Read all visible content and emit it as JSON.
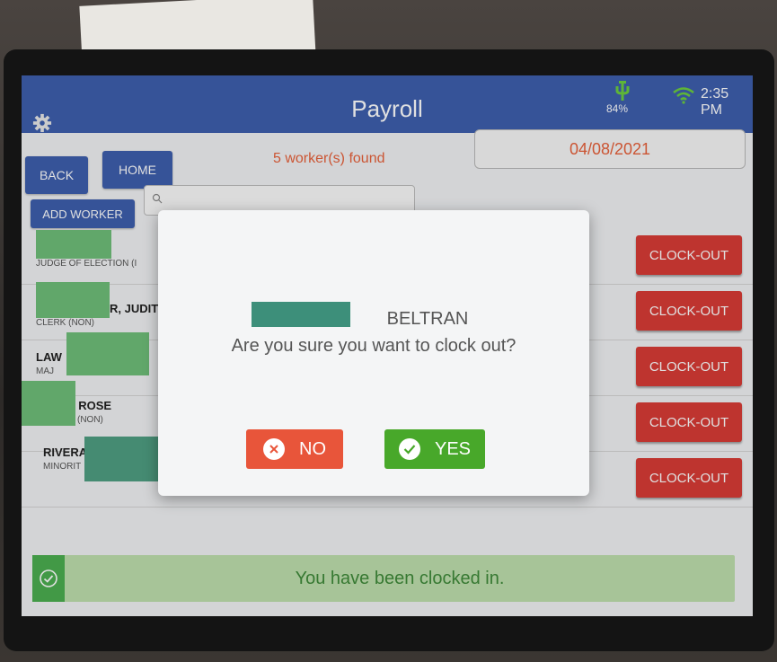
{
  "header": {
    "title": "Payroll",
    "battery_percent": "84%",
    "time": "2:35 PM",
    "icons": [
      "gear-icon",
      "battery-icon",
      "wifi-icon"
    ]
  },
  "toolbar": {
    "back_label": "BACK",
    "home_label": "HOME",
    "add_worker_label": "ADD WORKER",
    "workers_found": "5 worker(s) found",
    "date": "04/08/2021",
    "search_placeholder": ""
  },
  "workers": [
    {
      "name": "",
      "role": "JUDGE OF ELECTION (I",
      "action": "CLOCK-OUT"
    },
    {
      "name": "R, JUDIT",
      "role": "CLERK (NON)",
      "action": "CLOCK-OUT"
    },
    {
      "name": "LAW",
      "role": "MAJ",
      "action": "CLOCK-OUT"
    },
    {
      "name": ", ROSE",
      "role": "(NON)",
      "action": "CLOCK-OUT"
    },
    {
      "name": "RIVERA",
      "role": "MINORIT",
      "action": "CLOCK-OUT"
    }
  ],
  "dialog": {
    "worker_name": "BELTRAN",
    "question": "Are you sure you want to clock out?",
    "no_label": "NO",
    "yes_label": "YES"
  },
  "toast": {
    "message": "You have been clocked in."
  },
  "colors": {
    "header_blue": "#3e5fae",
    "clockout_red": "#d93c36",
    "no_red": "#e8553a",
    "yes_green": "#48a82a",
    "toast_green": "#bfe0ae",
    "accent_orange": "#e8613b"
  }
}
